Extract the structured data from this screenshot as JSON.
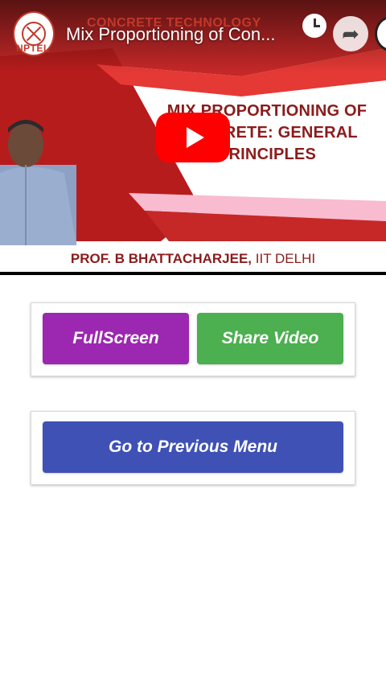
{
  "video": {
    "title": "Mix Proportioning of Con...",
    "course": "CONCRETE TECHNOLOGY",
    "logo_text": "NPTEL",
    "slide_heading_line1": "MIX PROPORTIONING OF",
    "slide_heading_line2": "CONCRETE: GENERAL",
    "slide_heading_line3": "PRINCIPLES",
    "presenter_bold": "PROF. B BHATTACHARJEE,",
    "presenter_rest": " IIT DELHI",
    "icons": {
      "clock": "clock-icon",
      "share": "share-icon",
      "play": "play-icon",
      "channel": "channel-avatar"
    }
  },
  "actions": {
    "fullscreen_label": "FullScreen",
    "share_label": "Share Video",
    "previous_menu_label": "Go to Previous Menu"
  },
  "colors": {
    "fullscreen": "#9c27b0",
    "share": "#4caf50",
    "previous": "#3f51b5",
    "slide_red": "#c0392b",
    "play": "#ff0000"
  }
}
